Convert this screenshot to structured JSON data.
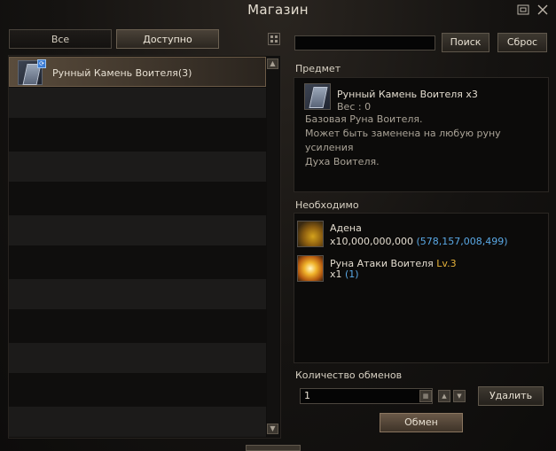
{
  "window": {
    "title": "Магазин"
  },
  "titlebar": {
    "minimize_icon": "minimize-icon",
    "close_icon": "close-icon"
  },
  "tabs": [
    {
      "label": "Все",
      "active": false
    },
    {
      "label": "Доступно",
      "active": true
    }
  ],
  "list": {
    "items": [
      {
        "name": "Рунный Камень Воителя(3)",
        "icon": "rune-stone-icon",
        "selected": true
      }
    ]
  },
  "search": {
    "placeholder": "",
    "search_label": "Поиск",
    "reset_label": "Сброс"
  },
  "item_panel": {
    "section_label": "Предмет",
    "name": "Рунный Камень Воителя x3",
    "weight_label": "Вес",
    "weight_sep": ":",
    "weight_value": "0",
    "description": [
      "Базовая Руна Воителя.",
      "Может быть заменена на любую руну усиления",
      "Духа Воителя."
    ]
  },
  "required": {
    "section_label": "Необходимо",
    "items": [
      {
        "name": "Адена",
        "qty": "x10,000,000,000",
        "have": "(578,157,008,499)",
        "icon": "adena-icon"
      },
      {
        "name": "Руна Атаки Воителя",
        "level": "Lv.3",
        "qty": "x1",
        "have": "(1)",
        "icon": "attack-rune-icon"
      }
    ]
  },
  "exchange": {
    "section_label": "Количество обменов",
    "value": "1",
    "delete_label": "Удалить",
    "exchange_label": "Обмен"
  },
  "colors": {
    "accent_blue": "#5aa9e6",
    "level_gold": "#e6b23a"
  }
}
